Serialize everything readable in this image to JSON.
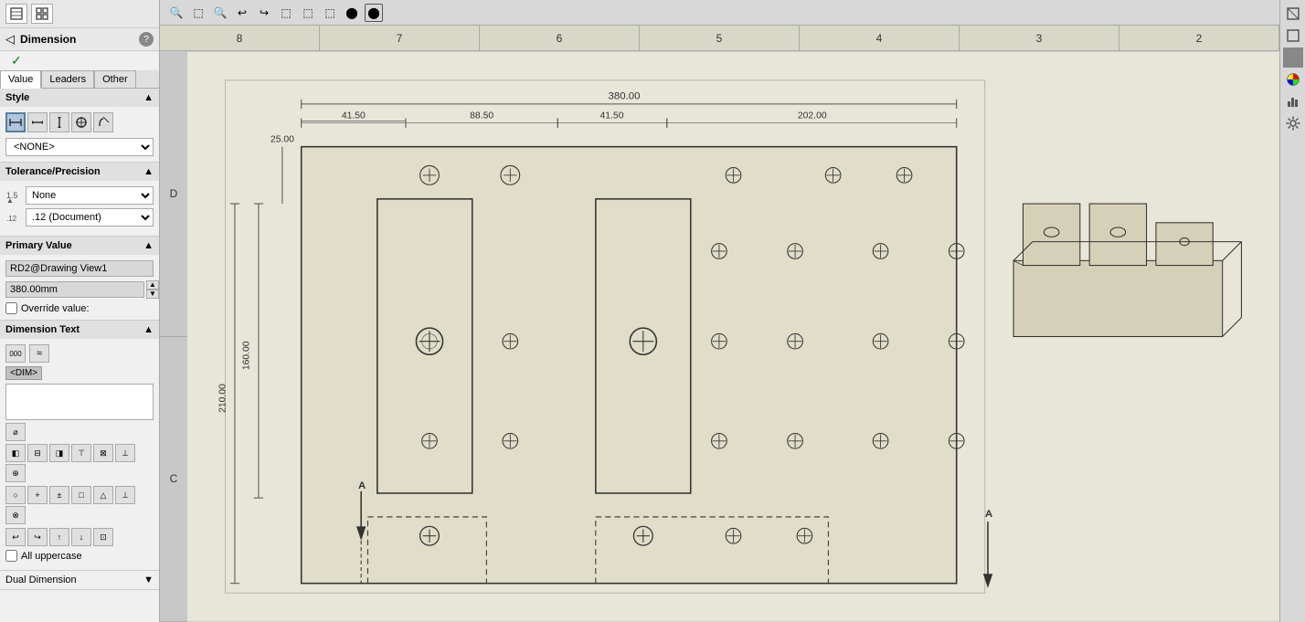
{
  "panel": {
    "title": "Dimension",
    "help_icon": "?",
    "accept_icon": "✓",
    "tabs": [
      {
        "id": "value",
        "label": "Value",
        "active": true
      },
      {
        "id": "leaders",
        "label": "Leaders",
        "active": false
      },
      {
        "id": "other",
        "label": "Other",
        "active": false
      }
    ],
    "style_section": {
      "label": "Style",
      "style_buttons": [
        {
          "id": "style1",
          "icon": "≡",
          "active": true
        },
        {
          "id": "style2",
          "icon": "↔",
          "active": false
        },
        {
          "id": "style3",
          "icon": "↕",
          "active": false
        },
        {
          "id": "style4",
          "icon": "⌀",
          "active": false
        },
        {
          "id": "style5",
          "icon": "R",
          "active": false
        }
      ],
      "dropdown_value": "<NONE>"
    },
    "tolerance_section": {
      "label": "Tolerance/Precision",
      "tol_type_icon": "1.5↑",
      "tol_dropdown_value": "None",
      "precision_icon": ".12",
      "precision_dropdown_value": ".12 (Document)"
    },
    "primary_value_section": {
      "label": "Primary Value",
      "source_value": "RD2@Drawing View1",
      "numeric_value": "380.00mm",
      "override_label": "Override value:"
    },
    "dim_text_section": {
      "label": "Dimension Text",
      "dim_tag": "<DIM>",
      "text_above": "",
      "text_below": "",
      "format_icons": [
        "000",
        "≈"
      ],
      "format_icons2": [
        "⌀"
      ],
      "align_icons": [
        "←",
        "↔",
        "→",
        "↑",
        "↕",
        "↓",
        "⊕"
      ],
      "sym_icons": [
        "○",
        "+",
        "±",
        "□",
        "△",
        "⊥",
        "⊗"
      ],
      "misc_icons": [
        "↩",
        "↪",
        "↑",
        "↓",
        "⊡"
      ],
      "uppercase_label": "All uppercase",
      "uppercase_checked": false
    },
    "dual_dim_section": {
      "label": "Dual Dimension",
      "expanded": false
    }
  },
  "toolbar": {
    "icons": [
      "🔍",
      "⬚",
      "🔍",
      "↩",
      "↪",
      "⬚",
      "⬚",
      "⬚",
      "⬤",
      "⬤"
    ]
  },
  "drawing": {
    "col_labels": [
      "8",
      "7",
      "6",
      "5",
      "4",
      "3",
      "2"
    ],
    "row_labels": [
      "D",
      "C"
    ],
    "dimensions": {
      "top_dim": "380.00",
      "dim_41_left": "41.50",
      "dim_88": "88.50",
      "dim_41_right": "41.50",
      "dim_202": "202.00",
      "dim_25": "25.00",
      "dim_160": "160.00",
      "dim_210": "210.00"
    },
    "section_label_a": "A",
    "section_label_a2": "A"
  },
  "right_toolbar": {
    "icons": [
      "⬜",
      "⬜",
      "⬛",
      "🎨",
      "📊",
      "⚙"
    ]
  }
}
